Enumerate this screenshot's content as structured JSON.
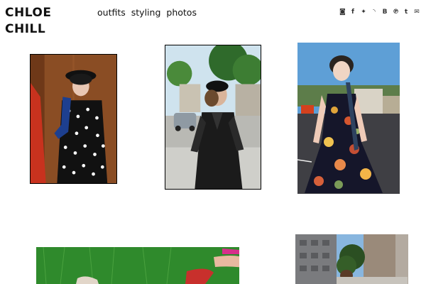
{
  "site": {
    "title_line1": "CHLOE",
    "title_line2": "CHILL"
  },
  "nav": {
    "items": [
      {
        "label": "outfits"
      },
      {
        "label": "styling"
      },
      {
        "label": "photos"
      }
    ]
  },
  "social": {
    "icons": [
      {
        "name": "instagram-icon",
        "glyph": "◙"
      },
      {
        "name": "facebook-icon",
        "glyph": "f"
      },
      {
        "name": "twitter-icon",
        "glyph": "✦"
      },
      {
        "name": "rss-icon",
        "glyph": "◝"
      },
      {
        "name": "bloglovin-icon",
        "glyph": "B"
      },
      {
        "name": "pinterest-icon",
        "glyph": "℗"
      },
      {
        "name": "tumblr-icon",
        "glyph": "t"
      },
      {
        "name": "email-icon",
        "glyph": "✉"
      }
    ]
  }
}
